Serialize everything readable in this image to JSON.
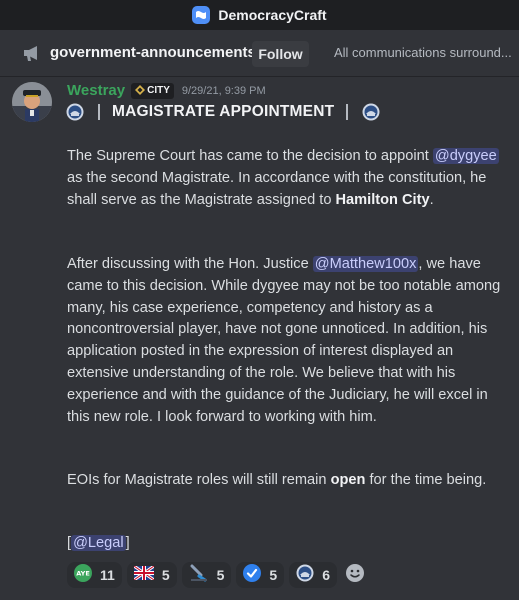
{
  "window": {
    "title": "DemocracyCraft"
  },
  "channel": {
    "name": "government-announcements",
    "follow_label": "Follow",
    "topic": "All communications surround..."
  },
  "message": {
    "author": "Westray",
    "tag": "CITY",
    "timestamp": "9/29/21, 9:39 PM",
    "heading": "MAGISTRATE APPOINTMENT",
    "p1_a": "The Supreme Court has came to the decision to appoint ",
    "p1_mention": "@dygyee",
    "p1_b": " as the second Magistrate. In accordance with the constitution, he shall serve as the Magistrate assigned to ",
    "p1_bold": "Hamilton City",
    "p1_c": ".",
    "p2_a": "After discussing with the Hon. Justice ",
    "p2_mention": "@Matthew100x",
    "p2_b": ", we have came to this decision. While dygyee may not be too notable among many, his case experience, competency and history as a noncontroversial player, have not gone unnoticed. In addition, his application posted in the expression of interest displayed an extensive understanding of the role. We believe that with his experience and with the guidance of the Judiciary, he will excel in this new role. I look forward to working with him.",
    "p3_a": "EOIs for Magistrate roles will still remain ",
    "p3_bold": "open",
    "p3_b": " for the time being.",
    "p4_open": "[",
    "p4_mention": "@Legal",
    "p4_close": "]"
  },
  "reactions": [
    {
      "icon": "aye-icon",
      "count": "11"
    },
    {
      "icon": "uk-flag-icon",
      "count": "5"
    },
    {
      "icon": "gavel-icon",
      "count": "5"
    },
    {
      "icon": "checkmark-icon",
      "count": "5"
    },
    {
      "icon": "gov-seal-icon",
      "count": "6"
    }
  ],
  "colors": {
    "background": "#313338",
    "username": "#3ba55d",
    "mention_bg": "#3c4270",
    "mention_text": "#c9cdfb"
  }
}
